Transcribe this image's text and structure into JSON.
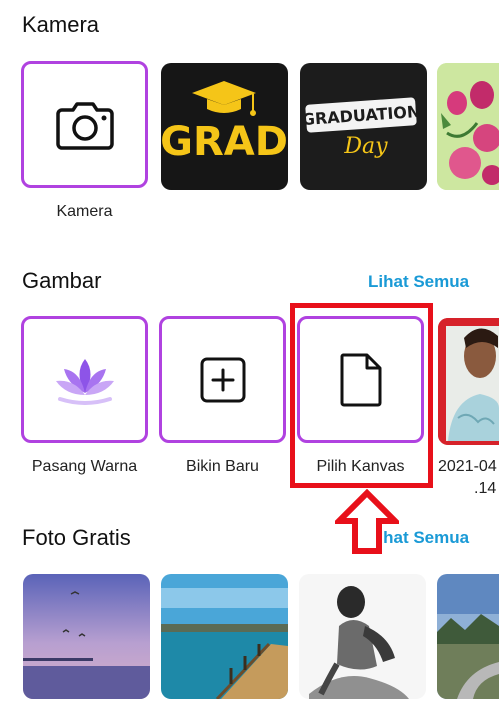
{
  "sections": {
    "kamera": {
      "title": "Kamera"
    },
    "gambar": {
      "title": "Gambar",
      "see_all": "Lihat Semua"
    },
    "foto_gratis": {
      "title": "Foto Gratis",
      "see_all": "Lihat Semua"
    }
  },
  "kamera_tiles": {
    "camera_label": "Kamera",
    "grad_text": "GRAD",
    "graduation_text": "GRADUATION",
    "day_text": "Day"
  },
  "gambar_tiles": {
    "pasang_warna": "Pasang Warna",
    "bikin_baru": "Bikin Baru",
    "pilih_kanvas": "Pilih Kanvas",
    "recent_line1": "2021-04",
    "recent_line2": ".14"
  },
  "colors": {
    "accent_purple": "#b042e0",
    "link_blue": "#1a9ad6",
    "highlight_red": "#e8101a"
  },
  "icons": {
    "camera": "camera-icon",
    "lotus": "lotus-icon",
    "add": "plus-square-icon",
    "file": "file-icon",
    "arrow": "up-arrow-icon"
  }
}
